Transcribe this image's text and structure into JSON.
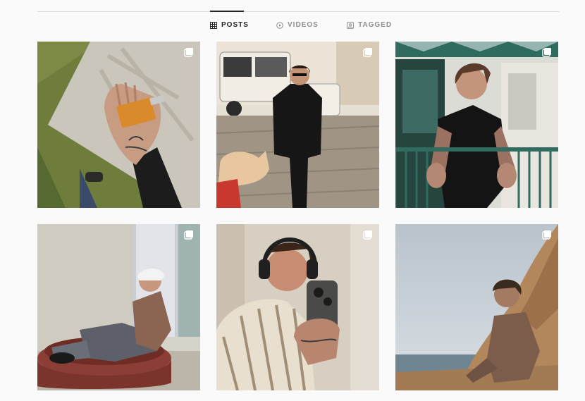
{
  "tabs": [
    {
      "label": "POSTS",
      "icon": "grid-icon",
      "active": true
    },
    {
      "label": "VIDEOS",
      "icon": "play-circle-icon",
      "active": false
    },
    {
      "label": "TAGGED",
      "icon": "tagged-icon",
      "active": false
    }
  ],
  "posts": [
    {
      "subject": "hand-holding-perfume",
      "badge": "carousel-icon"
    },
    {
      "subject": "man-walking-with-dog",
      "badge": "carousel-icon"
    },
    {
      "subject": "man-leaning-on-railing",
      "badge": "carousel-icon"
    },
    {
      "subject": "man-sitting-in-planter",
      "badge": "carousel-icon"
    },
    {
      "subject": "mirror-selfie-headphones",
      "badge": "carousel-icon"
    },
    {
      "subject": "man-sitting-on-rocks",
      "badge": "carousel-icon"
    }
  ],
  "colors": {
    "text": "#262626",
    "muted": "#8e8e8e",
    "divider": "#dbdbdb",
    "background": "#fafafa"
  }
}
